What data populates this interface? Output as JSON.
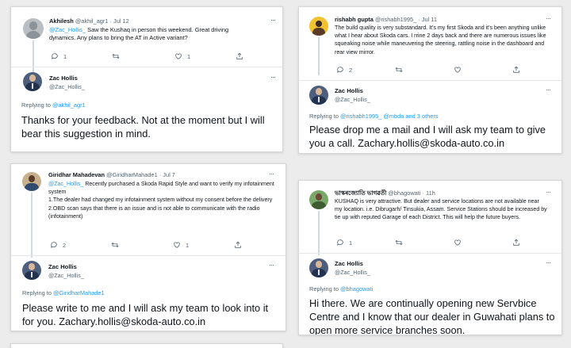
{
  "cards": {
    "akhilesh": {
      "orig": {
        "name": "Akhilesh",
        "handle": "@akhil_agr1",
        "time": "· Jul 12",
        "mention": "@Zac_Hollis_",
        "text": " Saw the Kushaq in person this weekend. Great driving dynamics. Any plans to bring the AT in Active variant?",
        "replies": "1",
        "retweets": "",
        "likes": "1"
      },
      "reply": {
        "name": "Zac Hollis",
        "handle": "@Zac_Hollis_",
        "replying_prefix": "Replying to ",
        "replying_to": "@akhil_agr1",
        "text": "Thanks for your feedback. Not at the moment but I will bear this suggestion in mind."
      }
    },
    "rishabh": {
      "orig": {
        "name": "rishabh gupta",
        "handle": "@rishabh1995_",
        "time": "· Jul 11",
        "text": "The build quality is very substandard. It's my first Skoda and it's been anything unlike what I hear about Skoda cars. I rrine 2 days back and there are numerous issues like squeaking noise while maneuvering the steering, rattling noise in the dashboard and rear view mirror.",
        "replies": "2",
        "retweets": "",
        "likes": ""
      },
      "reply": {
        "name": "Zac Hollis",
        "handle": "@Zac_Hollis_",
        "replying_prefix": "Replying to ",
        "replying_to": "@rishabh1995_ @mbda and 3 others",
        "text": "Please drop me a mail and I will ask my team to give you a call. Zachary.hollis@skoda-auto.co.in"
      }
    },
    "giridhar": {
      "orig": {
        "name": "Giridhar Mahadevan",
        "handle": "@GiridharMahade1",
        "time": "· Jul 7",
        "mention": "@Zac_Hollis_",
        "line1": " Recently purchased a Skoda Rapid Style and want to verify my infotainment system",
        "line2": "1.The dealer had changed my infotainment system without my consent before the delivery",
        "line3": "2.OBD scan says that there is an issue and is not able to communicate with the radio (infotainment)",
        "replies": "2",
        "retweets": "",
        "likes": "1"
      },
      "reply": {
        "name": "Zac Hollis",
        "handle": "@Zac_Hollis_",
        "replying_prefix": "Replying to ",
        "replying_to": "@GiridharMahade1",
        "text": "Please write to me and I will ask my team to look into it for you. Zachary.hollis@skoda-auto.co.in"
      }
    },
    "bhagowati": {
      "orig": {
        "name": "ভাস্কৰজ্যোতি ভাগৱতী",
        "handle": "@bhagowati",
        "time": "· 11h",
        "text": "KUSHAQ is very attractive. But dealer and service locations are not available near my location. i.e. Dibrugarh/ Tinsukia, Assam. Service Stations should be increased by tie up with reputed Garage of each District. This will help the future buyers.",
        "replies": "1",
        "retweets": "",
        "likes": ""
      },
      "reply": {
        "name": "Zac Hollis",
        "handle": "@Zac_Hollis_",
        "replying_prefix": "Replying to ",
        "replying_to": "@bhagowati",
        "text": "Hi there. We are continually opening new Servbice Centre and I know that our dealer in Guwahati plans to open more service branches soon."
      }
    }
  },
  "icons": {
    "reply": "reply-icon",
    "retweet": "retweet-icon",
    "like": "heart-icon",
    "share": "share-icon",
    "more": "more-icon"
  },
  "colors": {
    "link": "#1d9bf0",
    "text": "#0f1419",
    "muted": "#536471"
  }
}
